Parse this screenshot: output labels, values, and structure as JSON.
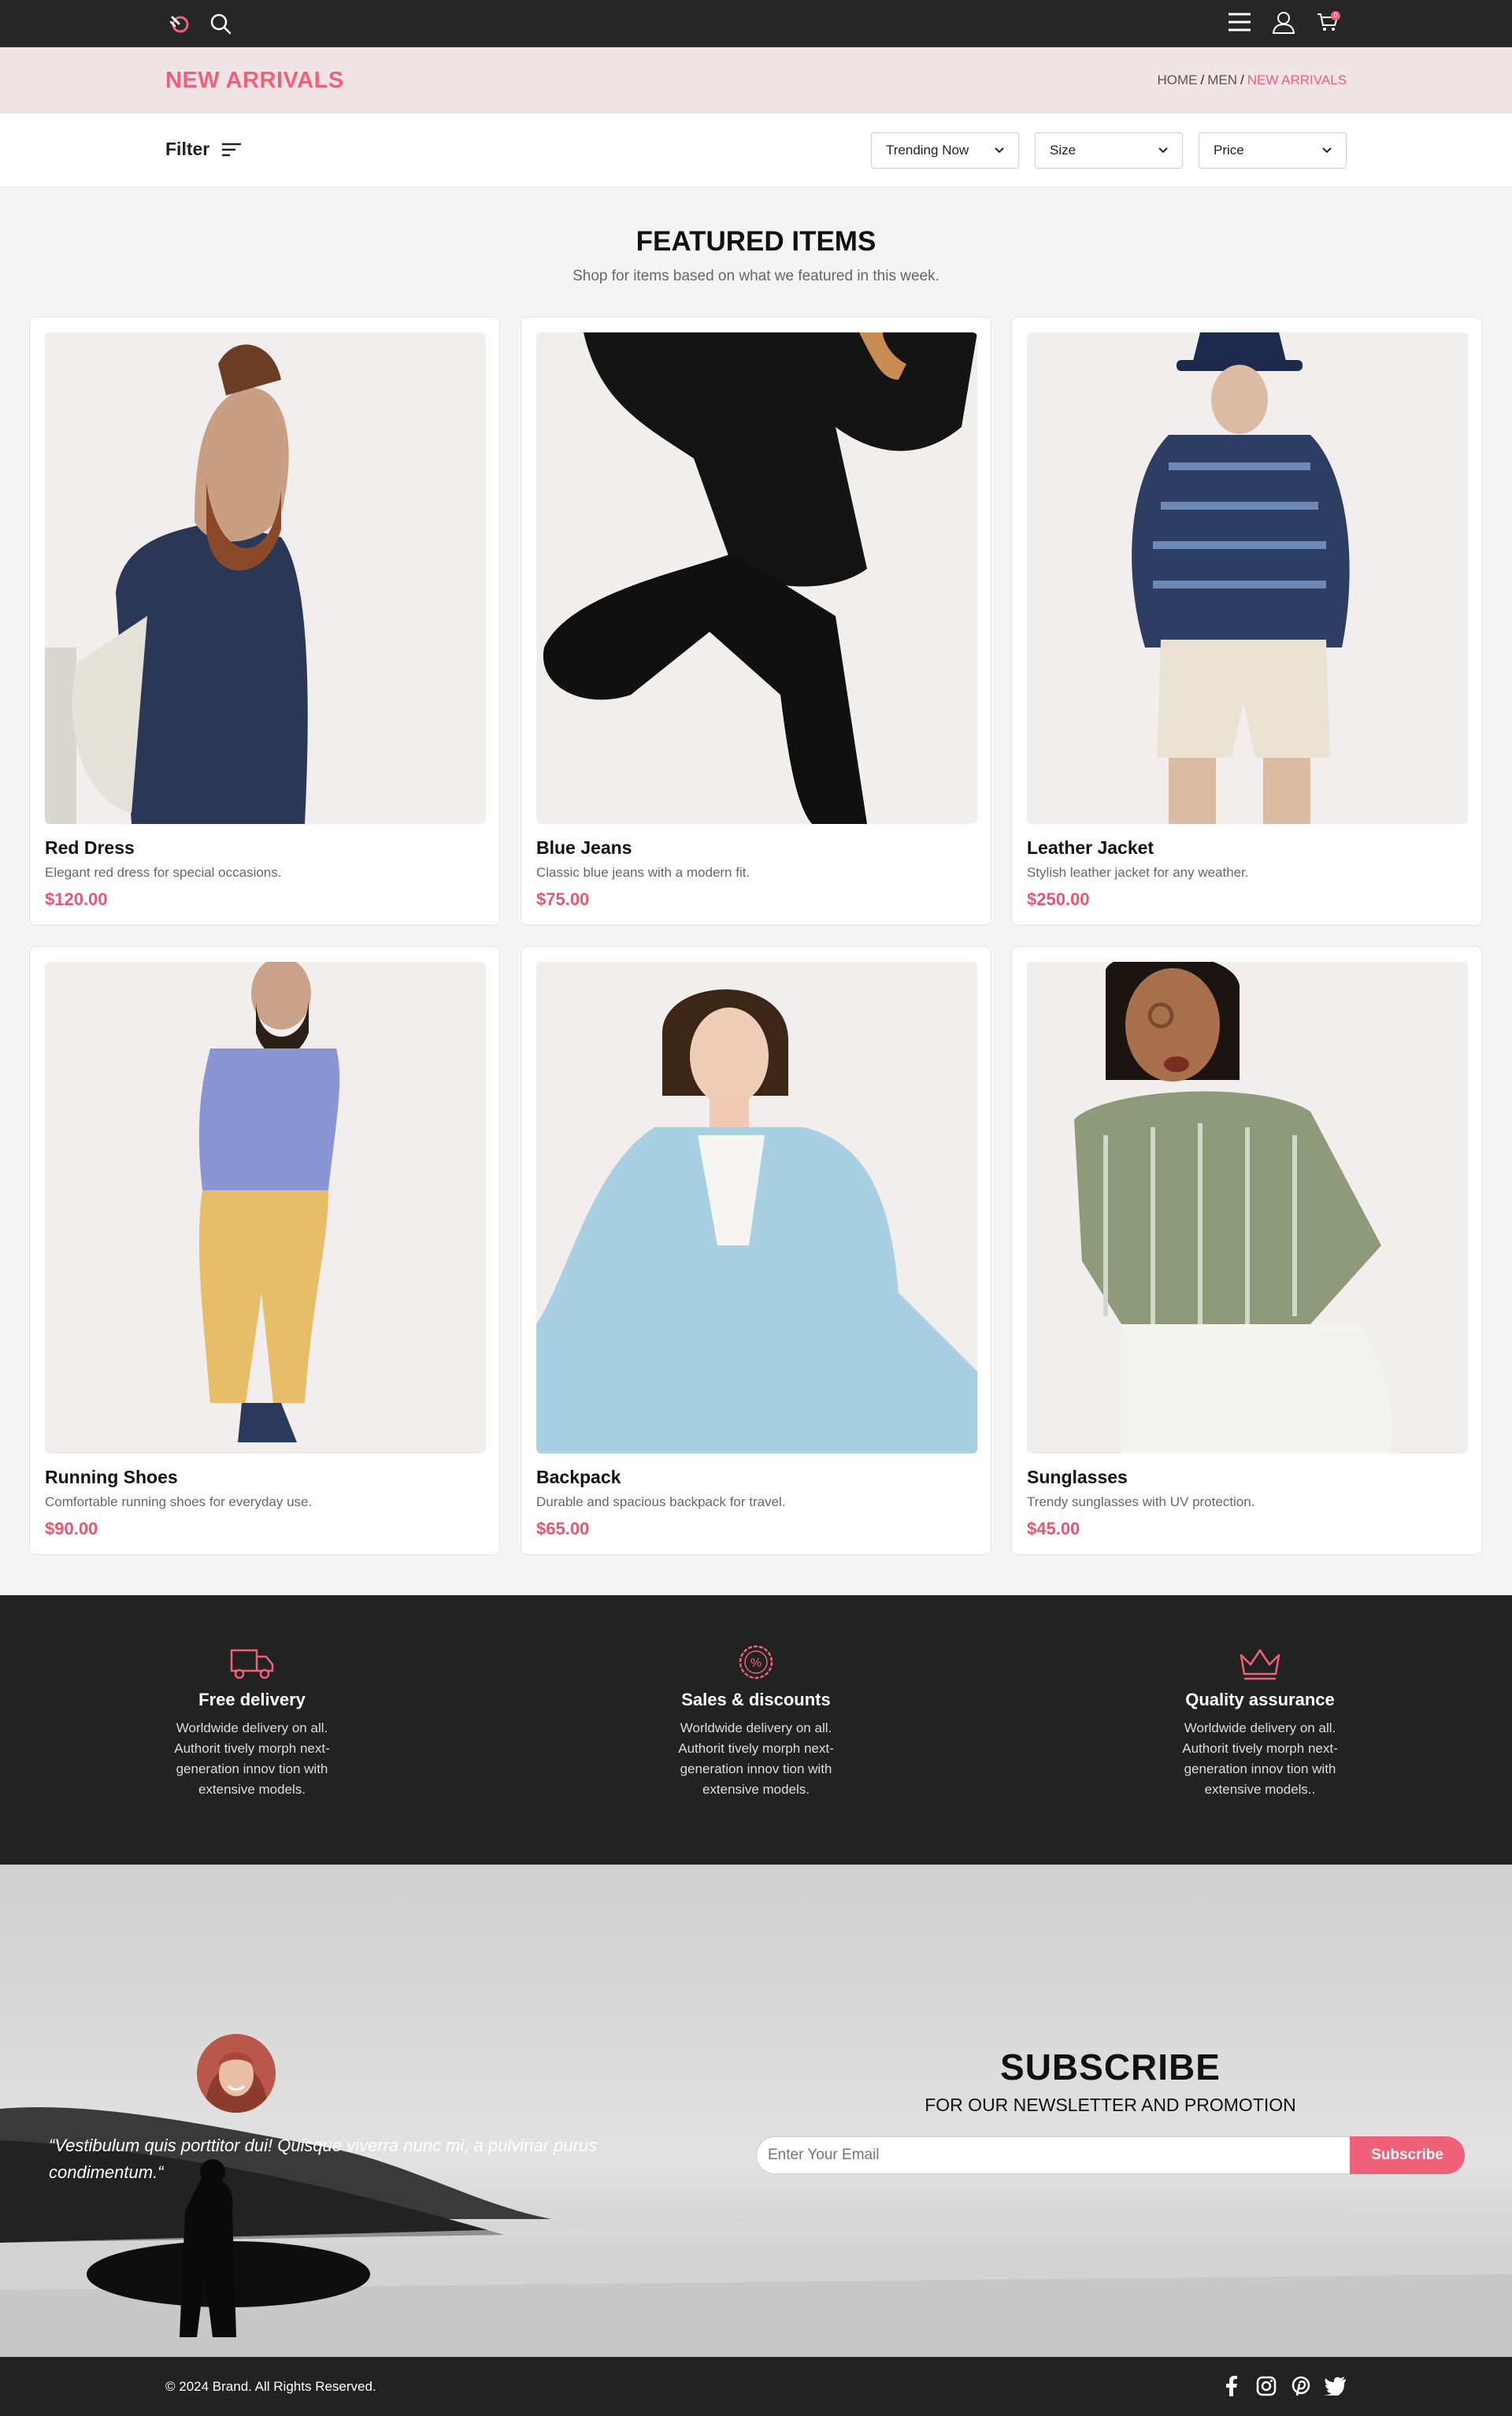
{
  "colors": {
    "accent": "#f06079",
    "nav_bg": "#262626",
    "header_band": "#f1e4e6",
    "dark_section": "#222223"
  },
  "nav": {
    "left_icons": [
      "logo-icon",
      "search-icon"
    ],
    "right_icons": [
      "menu-icon",
      "user-icon",
      "cart-icon"
    ],
    "cart_count": "0"
  },
  "header": {
    "title": "NEW ARRIVALS",
    "breadcrumb": [
      "HOME",
      "MEN",
      "NEW ARRIVALS"
    ],
    "separator": "/"
  },
  "filterbar": {
    "filter_label": "Filter",
    "selects": [
      "Trending Now",
      "Size",
      "Price"
    ]
  },
  "featured": {
    "title": "FEATURED ITEMS",
    "subtitle": "Shop for items based on what we featured in this week.",
    "products": [
      {
        "name": "Red Dress",
        "desc": "Elegant red dress for special occasions.",
        "price": "$120.00"
      },
      {
        "name": "Blue Jeans",
        "desc": "Classic blue jeans with a modern fit.",
        "price": "$75.00"
      },
      {
        "name": "Leather Jacket",
        "desc": "Stylish leather jacket for any weather.",
        "price": "$250.00"
      },
      {
        "name": "Running Shoes",
        "desc": "Comfortable running shoes for everyday use.",
        "price": "$90.00"
      },
      {
        "name": "Backpack",
        "desc": "Durable and spacious backpack for travel.",
        "price": "$65.00"
      },
      {
        "name": "Sunglasses",
        "desc": "Trendy sunglasses with UV protection.",
        "price": "$45.00"
      }
    ]
  },
  "features": [
    {
      "icon": "truck-icon",
      "title": "Free delivery",
      "lines": [
        "Worldwide delivery on all.",
        "Authorit tively morph next-",
        "generation innov tion with",
        "extensive models."
      ]
    },
    {
      "icon": "discount-badge-icon",
      "title": "Sales & discounts",
      "lines": [
        "Worldwide delivery on all.",
        "Authorit tively morph next-",
        "generation innov tion with",
        "extensive models."
      ]
    },
    {
      "icon": "crown-icon",
      "title": "Quality assurance",
      "lines": [
        "Worldwide delivery on all.",
        "Authorit tively morph next-",
        "generation innov tion with",
        "extensive models.."
      ]
    }
  ],
  "testimonial": {
    "quote_line1": "“Vestibulum quis porttitor dui! Quisque viverra nunc mi, a pulvinar purus",
    "quote_line2": "condimentum.“"
  },
  "subscribe": {
    "title": "SUBSCRIBE",
    "subtitle": "FOR OUR NEWSLETTER AND PROMOTION",
    "placeholder": "Enter Your Email",
    "button": "Subscribe"
  },
  "footer": {
    "copyright": "© 2024 Brand. All Rights Reserved.",
    "socials": [
      "facebook-icon",
      "instagram-icon",
      "pinterest-icon",
      "twitter-icon"
    ]
  }
}
